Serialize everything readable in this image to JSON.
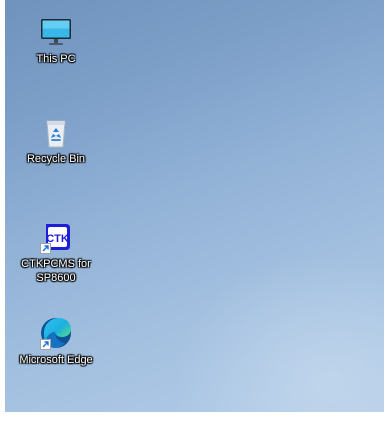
{
  "desktop": {
    "icons": [
      {
        "label": "This PC",
        "icon": "monitor-icon"
      },
      {
        "label": "Recycle Bin",
        "icon": "recycle-bin-icon"
      },
      {
        "label": "CTKPCMS for SP8600",
        "icon": "ctk-app-icon",
        "shortcut": true
      },
      {
        "label": "Microsoft Edge",
        "icon": "edge-icon",
        "shortcut": true
      }
    ]
  },
  "ctk_logo_text": "CTK"
}
